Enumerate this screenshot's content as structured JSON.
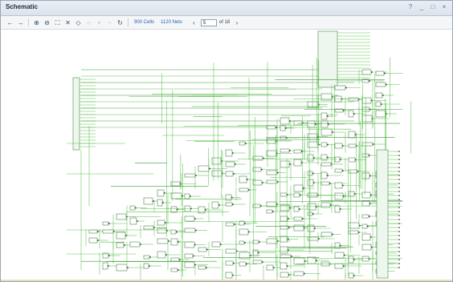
{
  "window": {
    "title": "Schematic",
    "controls": [
      "?",
      "_",
      "□",
      "×"
    ]
  },
  "toolbar": {
    "buttons": [
      {
        "name": "back-icon",
        "glyph": "←",
        "enabled": true
      },
      {
        "name": "forward-icon",
        "glyph": "→",
        "enabled": true
      },
      {
        "name": "zoom-in-icon",
        "glyph": "⊕",
        "enabled": true
      },
      {
        "name": "zoom-out-icon",
        "glyph": "⊖",
        "enabled": true
      },
      {
        "name": "zoom-fit-icon",
        "glyph": "⛶",
        "enabled": true
      },
      {
        "name": "zoom-area-icon",
        "glyph": "✕",
        "enabled": true
      },
      {
        "name": "select-area-icon",
        "glyph": "◇",
        "enabled": true
      },
      {
        "name": "dimmed-option-icon",
        "glyph": "○",
        "enabled": false
      },
      {
        "name": "add-icon",
        "glyph": "+",
        "enabled": false
      },
      {
        "name": "remove-icon",
        "glyph": "−",
        "enabled": false
      },
      {
        "name": "refresh-icon",
        "glyph": "↻",
        "enabled": true
      }
    ],
    "cells_link": "900 Cells",
    "nets_link": "1120 Nets",
    "page_current": "5",
    "page_total": "of 18"
  },
  "colors": {
    "wire": "#58c24a",
    "wire_dark": "#3f9a36",
    "component": "#2f6a2f",
    "accent_link": "#2a62b5"
  }
}
